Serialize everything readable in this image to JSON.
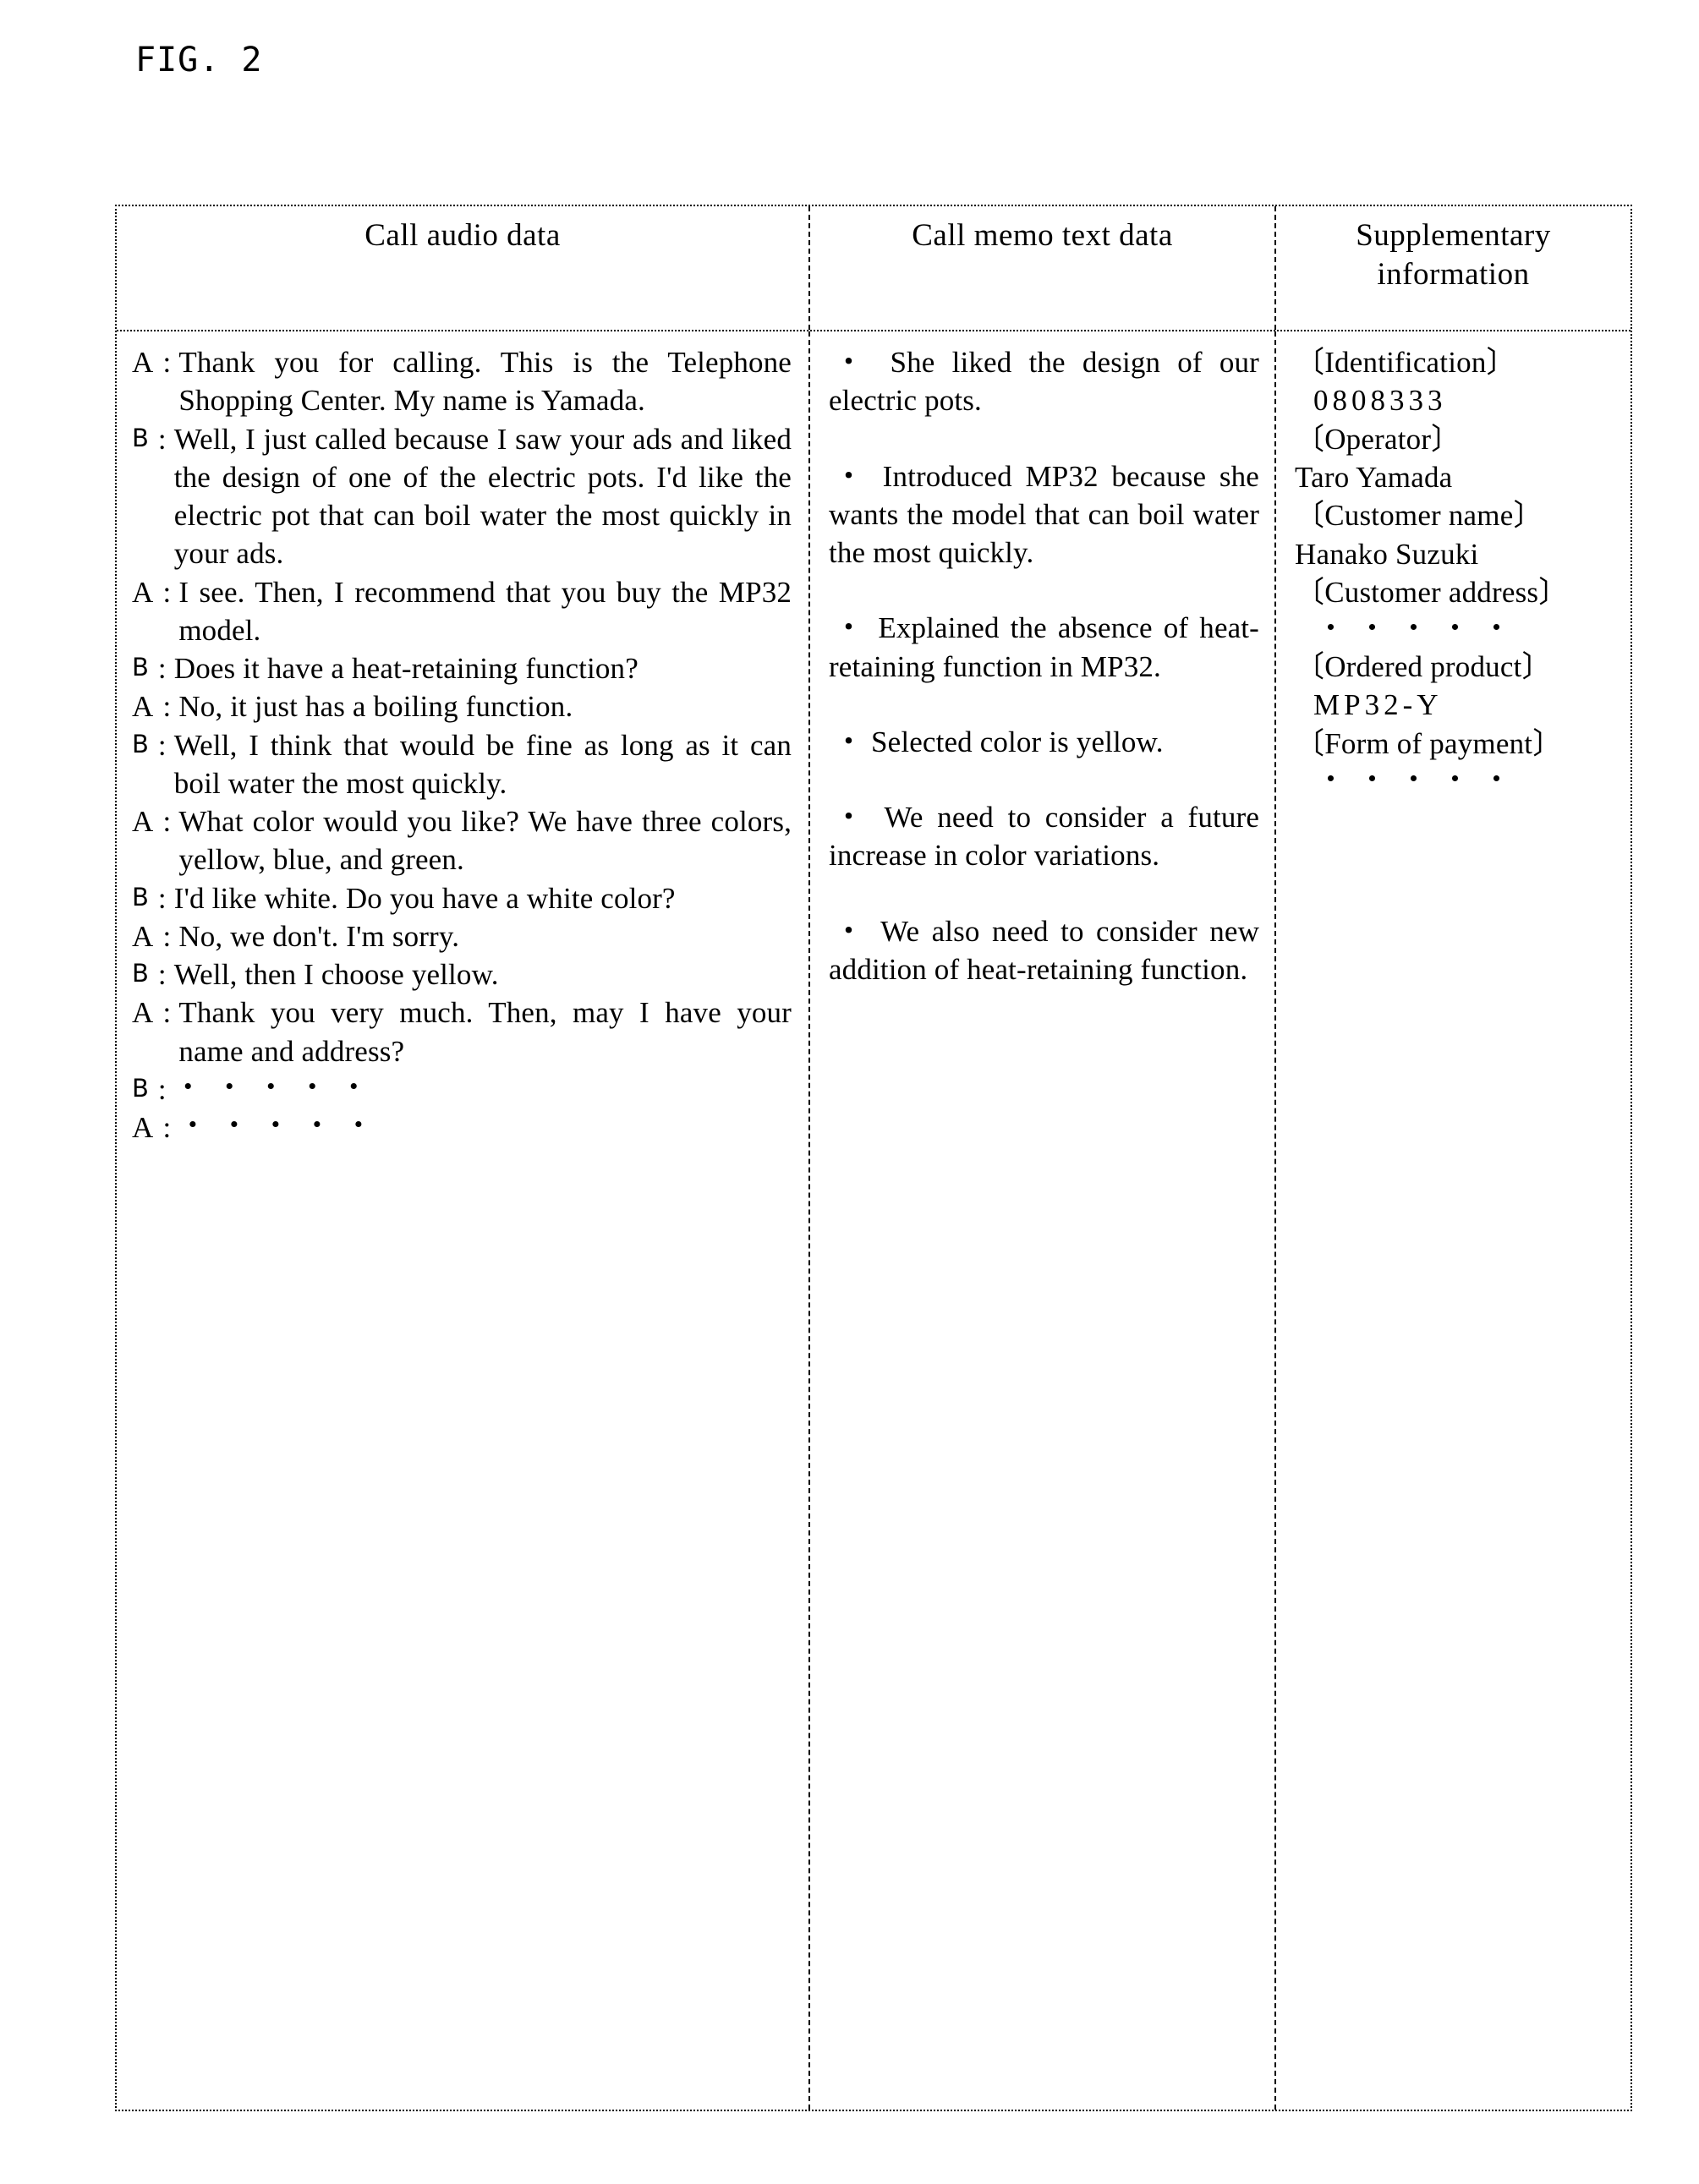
{
  "figure": {
    "label": "FIG. 2"
  },
  "table": {
    "headers": {
      "call_audio_data": "Call audio data",
      "call_memo_text_data": "Call memo text data",
      "supplementary_information_line1": "Supplementary",
      "supplementary_information_line2": "information"
    },
    "call_audio_data": {
      "turns": [
        {
          "speaker": "A",
          "text": "Thank you for calling.   This is the Telephone Shopping Center.   My name is Yamada."
        },
        {
          "speaker": "B",
          "text": "Well, I just called because I saw your ads and liked the design of one of the electric pots.   I'd like the electric pot that can boil water the most quickly in your ads."
        },
        {
          "speaker": "A",
          "text": "I see.   Then, I recommend that you buy the MP32 model."
        },
        {
          "speaker": "B",
          "text": "Does it have a heat-retaining function?"
        },
        {
          "speaker": "A",
          "text": "No, it just has a boiling function."
        },
        {
          "speaker": "B",
          "text": "Well, I think that would be fine as long as it can boil water the most quickly."
        },
        {
          "speaker": "A",
          "text": "What color would you like?   We have three colors, yellow, blue, and green."
        },
        {
          "speaker": "B",
          "text": "I'd like white.   Do you have a white color?"
        },
        {
          "speaker": "A",
          "text": "No, we don't.   I'm sorry."
        },
        {
          "speaker": "B",
          "text": "Well, then I choose yellow."
        },
        {
          "speaker": "A",
          "text": "Thank you very much.   Then, may I have your name and address?"
        },
        {
          "speaker": "B",
          "text": "・・・・・"
        },
        {
          "speaker": "A",
          "text": "・・・・・"
        }
      ],
      "separator": ":"
    },
    "call_memo_text_data": {
      "bullet": "・",
      "items": [
        "She liked the design of our electric pots.",
        "Introduced MP32 because she wants the model that can boil water the most quickly.",
        "Explained the absence of heat-retaining function in MP32.",
        "Selected color is yellow.",
        "We need to consider a future increase in color variations.",
        "We also need to consider new addition of heat-retaining function."
      ]
    },
    "supplementary_information": {
      "entries": [
        {
          "key": "〔Identification〕",
          "value": "0808333",
          "style": "spaced"
        },
        {
          "key": "〔Operator〕",
          "value": "Taro Yamada",
          "style": "plain"
        },
        {
          "key": "〔Customer name〕",
          "value": "Hanako Suzuki",
          "style": "plain"
        },
        {
          "key": "〔Customer address〕",
          "value": "・・・・・",
          "style": "dots"
        },
        {
          "key": "〔Ordered product〕",
          "value": "MP32-Y",
          "style": "spaced"
        },
        {
          "key": "〔Form of payment〕",
          "value": "・・・・・",
          "style": "dots"
        }
      ]
    }
  }
}
